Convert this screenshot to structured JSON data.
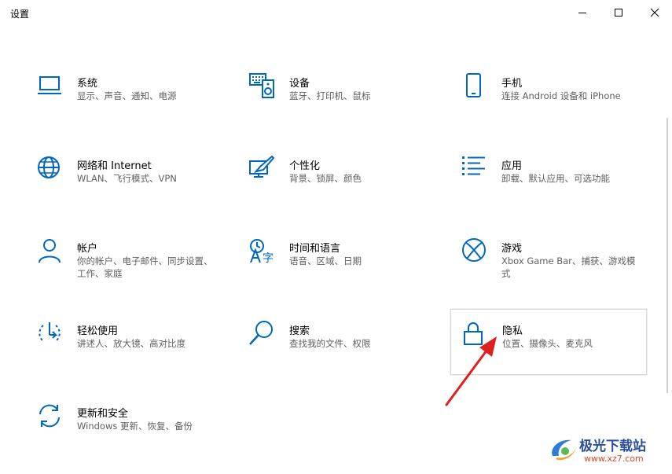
{
  "window": {
    "title": "设置",
    "controls": [
      "minimize-icon",
      "maximize-icon",
      "close-icon"
    ]
  },
  "accent_color": "#0067c0",
  "tiles": [
    {
      "name": "系统",
      "desc": "显示、声音、通知、电源",
      "icon": "laptop-icon"
    },
    {
      "name": "设备",
      "desc": "蓝牙、打印机、鼠标",
      "icon": "keyboard-speaker-icon"
    },
    {
      "name": "手机",
      "desc": "连接 Android 设备和 iPhone",
      "icon": "phone-icon"
    },
    {
      "name": "网络和 Internet",
      "desc": "WLAN、飞行模式、VPN",
      "icon": "globe-icon"
    },
    {
      "name": "个性化",
      "desc": "背景、锁屏、颜色",
      "icon": "paintbrush-icon"
    },
    {
      "name": "应用",
      "desc": "卸载、默认应用、可选功能",
      "icon": "app-list-icon"
    },
    {
      "name": "帐户",
      "desc": "你的帐户、电子邮件、同步设置、工作、家庭",
      "icon": "person-icon"
    },
    {
      "name": "时间和语言",
      "desc": "语音、区域、日期",
      "icon": "time-language-icon"
    },
    {
      "name": "游戏",
      "desc": "Xbox Game Bar、捕获、游戏模式",
      "icon": "xbox-icon"
    },
    {
      "name": "轻松使用",
      "desc": "讲述人、放大镜、高对比度",
      "icon": "ease-of-access-icon"
    },
    {
      "name": "搜索",
      "desc": "查找我的文件、权限",
      "icon": "search-icon"
    },
    {
      "name": "隐私",
      "desc": "位置、摄像头、麦克风",
      "icon": "lock-icon"
    },
    {
      "name": "更新和安全",
      "desc": "Windows 更新、恢复、备份",
      "icon": "sync-arrows-icon"
    }
  ],
  "annotation": {
    "color": "#e02020",
    "points_to": "隐私"
  },
  "watermark": {
    "text": "极光下载站",
    "url": "www.xz7.com",
    "logo": "swirl-logo-icon"
  }
}
